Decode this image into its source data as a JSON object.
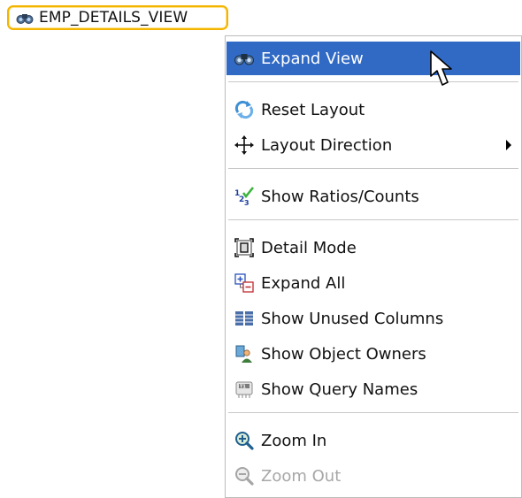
{
  "node": {
    "label": "EMP_DETAILS_VIEW",
    "icon": "binoculars-icon",
    "border_color": "#f3b400"
  },
  "menu": {
    "highlight_color": "#316ac5",
    "items": [
      {
        "label": "Expand View",
        "icon": "binoculars-icon",
        "state": "highlighted"
      },
      {
        "label": "Reset Layout",
        "icon": "refresh-arrows-icon",
        "state": "enabled"
      },
      {
        "label": "Layout Direction",
        "icon": "move-arrows-icon",
        "state": "enabled",
        "has_submenu": true
      },
      {
        "label": "Show Ratios/Counts",
        "icon": "ratios-counts-icon",
        "state": "enabled"
      },
      {
        "label": "Detail Mode",
        "icon": "detail-mode-icon",
        "state": "enabled"
      },
      {
        "label": "Expand All",
        "icon": "expand-all-icon",
        "state": "enabled"
      },
      {
        "label": "Show Unused Columns",
        "icon": "columns-icon",
        "state": "enabled"
      },
      {
        "label": "Show Object Owners",
        "icon": "object-owner-icon",
        "state": "enabled"
      },
      {
        "label": "Show Query Names",
        "icon": "query-names-icon",
        "state": "enabled"
      },
      {
        "label": "Zoom In",
        "icon": "zoom-in-icon",
        "state": "enabled"
      },
      {
        "label": "Zoom Out",
        "icon": "zoom-out-icon",
        "state": "disabled"
      }
    ]
  }
}
